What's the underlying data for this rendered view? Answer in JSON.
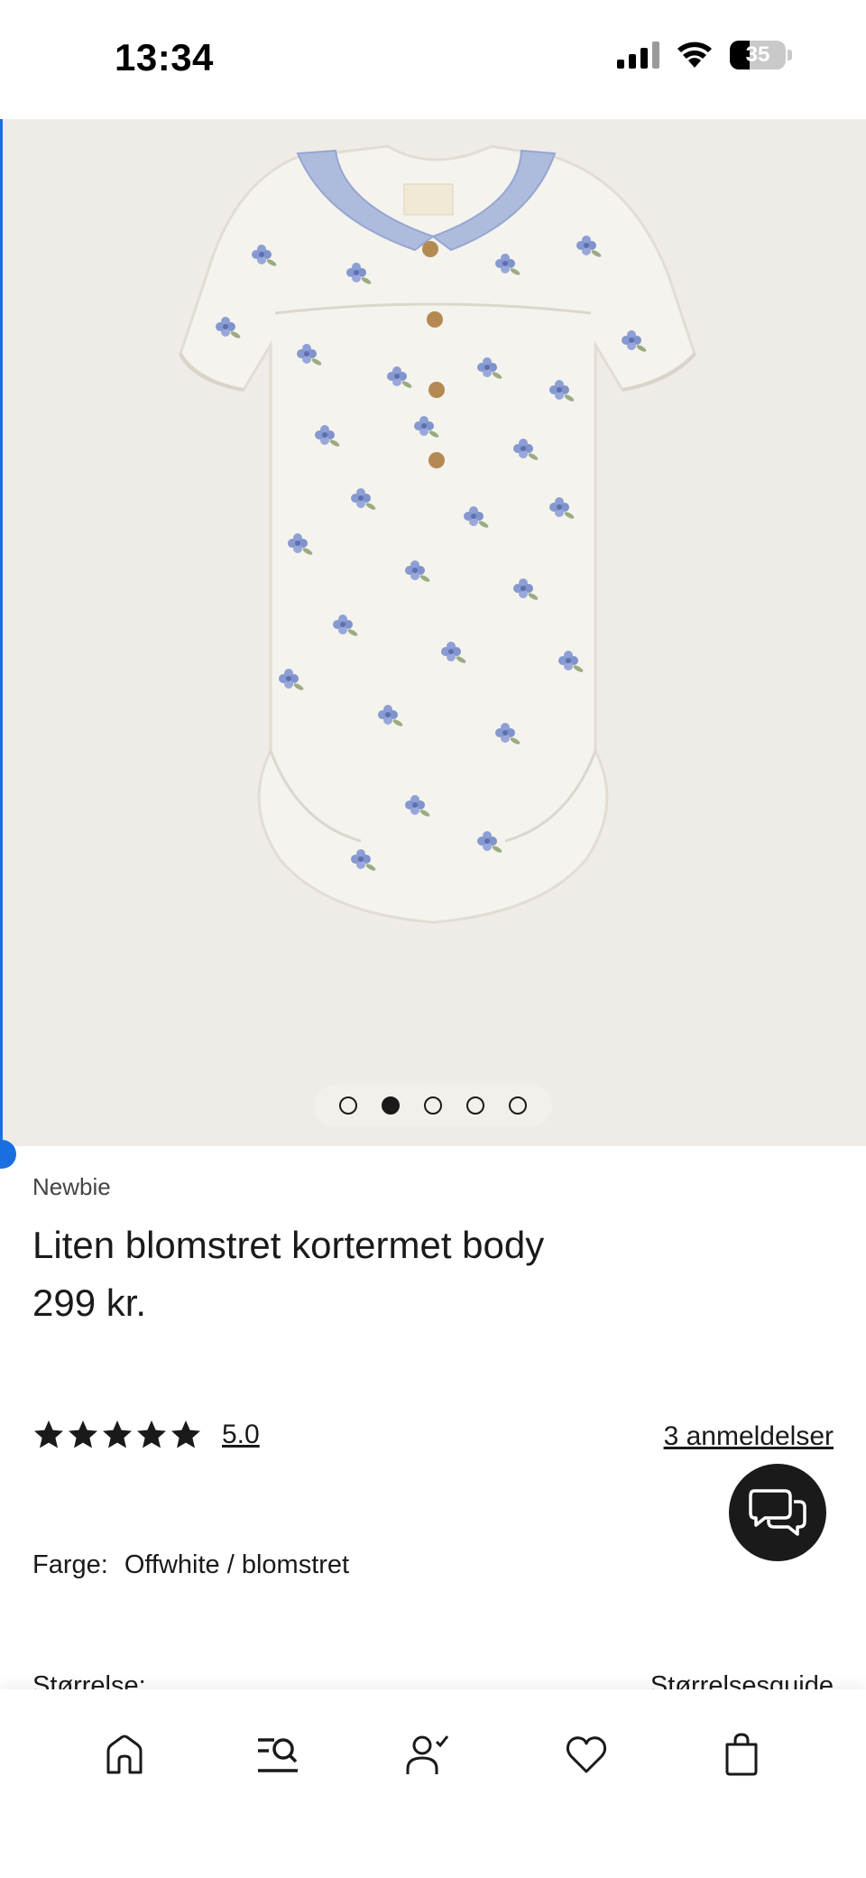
{
  "status_bar": {
    "time": "13:34",
    "battery_percent": 35,
    "battery_label": "35",
    "signal_bars": 4,
    "wifi": true
  },
  "product_image": {
    "description_icon": "baby-bodysuit-photo",
    "background_color": "#efebe6",
    "carousel": {
      "count": 5,
      "active_index": 1
    }
  },
  "product": {
    "brand": "Newbie",
    "title": "Liten blomstret kortermet body",
    "price": "299 kr."
  },
  "rating": {
    "stars": 5,
    "value": "5.0",
    "reviews_label": "3 anmeldelser"
  },
  "color": {
    "label": "Farge:",
    "value": "Offwhite / blomstret"
  },
  "size": {
    "label": "Størrelse:",
    "guide_label": "Størrelsesguide"
  },
  "chat": {
    "icon": "chat-bubbles-icon"
  },
  "bottom_nav": {
    "items": [
      {
        "icon": "home-icon"
      },
      {
        "icon": "search-menu-icon"
      },
      {
        "icon": "account-icon"
      },
      {
        "icon": "heart-icon"
      },
      {
        "icon": "shopping-bag-icon"
      }
    ]
  },
  "colors": {
    "accent": "#1a6fe0",
    "text": "#1a1a1a",
    "fab": "#1a1a1a"
  }
}
